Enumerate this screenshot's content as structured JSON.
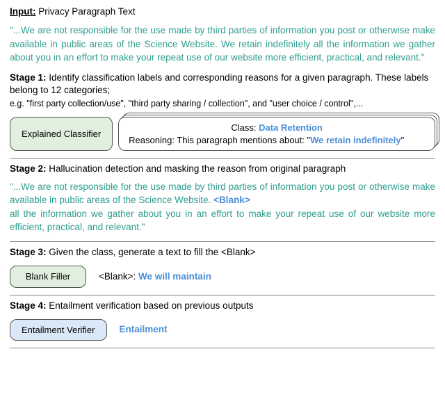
{
  "input": {
    "label": "Input:",
    "title": "Privacy Paragraph Text",
    "paragraph": "\"...We are not responsible for the use made by third parties of information you post or otherwise make available in public areas of the Science Website. We retain indefinitely all the information we gather about you in an effort to make your repeat use of our website more efficient, practical, and relevant.\""
  },
  "stage1": {
    "label": "Stage 1:",
    "desc": "Identify classification labels and corresponding reasons for a given paragraph. These labels belong to 12 categories;",
    "example": "e.g. \"first party collection/use\", \"third party sharing / collection\", and \"user choice / control\",...",
    "module": "Explained Classifier",
    "class_label": "Class: ",
    "class_value": "Data Retention",
    "reason_label": "Reasoning: This paragraph mentions about: \"",
    "reason_value": "We retain indefinitely",
    "reason_suffix": "\""
  },
  "stage2": {
    "label": "Stage 2:",
    "desc": "Hallucination detection and masking the reason from original paragraph",
    "paragraph_pre": "\"...We are not responsible for the use made by third parties of information you post or otherwise make available in public areas of the Science Website. ",
    "blank": "<Blank>",
    "paragraph_post": " all the information we gather about you in an effort to make your repeat use of our website more efficient, practical, and relevant.\""
  },
  "stage3": {
    "label": "Stage 3:",
    "desc": "Given the class, generate a text to fill the <Blank>",
    "module": "Blank Filler",
    "out_label": "<Blank>: ",
    "out_value": "We will maintain"
  },
  "stage4": {
    "label": "Stage 4:",
    "desc": "Entailment verification based on previous outputs",
    "module": "Entailment Verifier",
    "out_value": "Entailment"
  }
}
